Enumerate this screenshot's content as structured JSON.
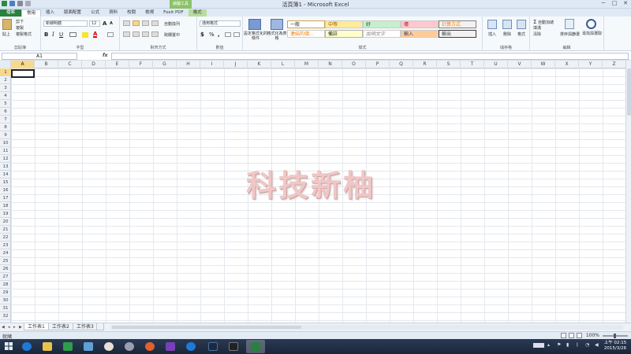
{
  "window": {
    "title": "活頁簿1 - Microsoft Excel",
    "context_group": "繪圖工具",
    "minimize": "─",
    "maximize": "□",
    "close": "✕"
  },
  "tabs": [
    "檔案",
    "常用",
    "插入",
    "版面配置",
    "公式",
    "資料",
    "校閱",
    "檢視",
    "Foxit PDF",
    "格式"
  ],
  "ribbon": {
    "clipboard": {
      "paste": "貼上",
      "cut": "剪下",
      "copy": "複製",
      "format_painter": "複製格式",
      "label": "剪貼簿"
    },
    "font": {
      "name": "新細明體",
      "size": "12",
      "bold": "B",
      "italic": "I",
      "underline": "U",
      "grow": "A",
      "shrink": "A",
      "label": "字型"
    },
    "alignment": {
      "wrap": "自動換列",
      "merge": "跨欄置中",
      "label": "對齊方式"
    },
    "number": {
      "format": "通用格式",
      "currency": "$",
      "percent": "%",
      "comma": ",",
      "label": "數值"
    },
    "styles": {
      "conditional": "設定格式化的條件",
      "as_table": "格式化為表格",
      "cells": [
        "一般",
        "中等",
        "好",
        "壞",
        "計算方式",
        "連結的儲...",
        "備註",
        "說明文字",
        "輸入",
        "輸出"
      ],
      "label": "樣式"
    },
    "cells_group": {
      "insert": "插入",
      "delete": "刪除",
      "format": "格式",
      "label": "儲存格"
    },
    "editing": {
      "autosum": "自動加總",
      "fill": "填滿",
      "clear": "清除",
      "sort": "排序與篩選",
      "find": "尋找與選取",
      "label": "編輯"
    }
  },
  "formula_bar": {
    "name_box": "A1",
    "fx": "fx",
    "value": ""
  },
  "columns": [
    "A",
    "B",
    "C",
    "D",
    "E",
    "F",
    "G",
    "H",
    "I",
    "J",
    "K",
    "L",
    "M",
    "N",
    "O",
    "P",
    "Q",
    "R",
    "S",
    "T",
    "U",
    "V",
    "W",
    "X",
    "Y",
    "Z"
  ],
  "rows": [
    "1",
    "2",
    "3",
    "4",
    "5",
    "6",
    "7",
    "8",
    "9",
    "10",
    "11",
    "12",
    "13",
    "14",
    "15",
    "16",
    "17",
    "18",
    "19",
    "20",
    "21",
    "22",
    "23",
    "24",
    "25",
    "26",
    "27",
    "28",
    "29",
    "30",
    "31",
    "32"
  ],
  "watermark": "科技新柚",
  "sheets": [
    "工作表1",
    "工作表2",
    "工作表3"
  ],
  "status": {
    "text": "就緒",
    "zoom": "100%"
  },
  "clock": {
    "time": "上午 02:15",
    "date": "2015/3/26"
  },
  "colors": {
    "accent": "#2a8040",
    "selection": "#f8d98a"
  }
}
